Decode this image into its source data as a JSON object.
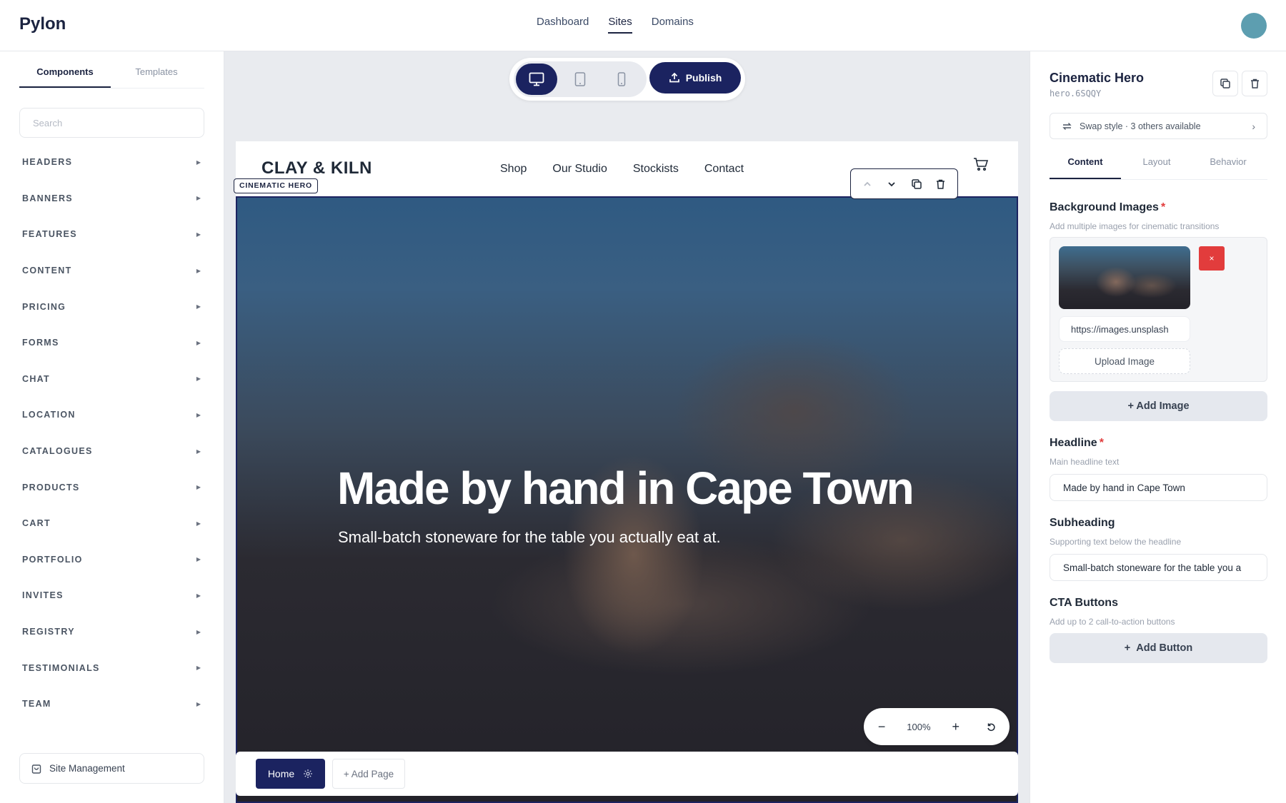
{
  "app": {
    "brand": "Pylon"
  },
  "topnav": {
    "items": [
      "Dashboard",
      "Sites",
      "Domains"
    ],
    "active": "Sites"
  },
  "sidebar": {
    "tabs": [
      "Components",
      "Templates"
    ],
    "search_placeholder": "Search",
    "categories": [
      "HEADERS",
      "BANNERS",
      "FEATURES",
      "CONTENT",
      "PRICING",
      "FORMS",
      "CHAT",
      "LOCATION",
      "CATALOGUES",
      "PRODUCTS",
      "CART",
      "PORTFOLIO",
      "INVITES",
      "REGISTRY",
      "TESTIMONIALS",
      "TEAM"
    ],
    "site_management": "Site Management"
  },
  "toolbar": {
    "publish_label": "Publish"
  },
  "site": {
    "logo": "CLAY & KILN",
    "nav": [
      "Shop",
      "Our Studio",
      "Stockists",
      "Contact"
    ],
    "selected_block_label": "CINEMATIC HERO",
    "hero_headline": "Made by hand in Cape Town",
    "hero_subheading": "Small-batch stoneware for the table you actually eat at."
  },
  "zoom": {
    "level": "100%"
  },
  "pages": {
    "home": "Home",
    "add_page": "+ Add Page"
  },
  "panel": {
    "title": "Cinematic Hero",
    "id": "hero.6SQQY",
    "swap_style": "Swap style · 3 others available",
    "tabs": [
      "Content",
      "Layout",
      "Behavior"
    ],
    "background_images": {
      "label": "Background Images",
      "help": "Add multiple images for cinematic transitions",
      "url_value": "https://images.unsplash",
      "remove": "×",
      "upload": "Upload Image",
      "add": "+ Add Image"
    },
    "headline": {
      "label": "Headline",
      "help": "Main headline text",
      "value": "Made by hand in Cape Town"
    },
    "subheading": {
      "label": "Subheading",
      "help": "Supporting text below the headline",
      "value": "Small-batch stoneware for the table you a"
    },
    "cta": {
      "label": "CTA Buttons",
      "help": "Add up to 2 call-to-action buttons",
      "add": "Add Button"
    },
    "required_mark": "*"
  },
  "colors": {
    "brand_navy": "#1b2360",
    "danger": "#e23c3c",
    "avatar": "#5d9eb0"
  }
}
